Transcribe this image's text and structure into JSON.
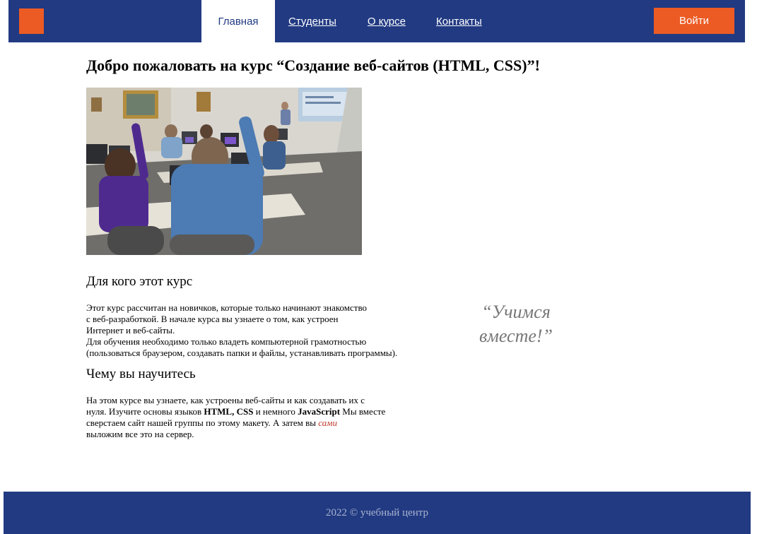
{
  "header": {
    "nav": [
      {
        "label": "Главная",
        "active": true
      },
      {
        "label": "Студенты",
        "active": false
      },
      {
        "label": "О курсе",
        "active": false
      },
      {
        "label": "Контакты",
        "active": false
      }
    ],
    "login_label": "Войти"
  },
  "main": {
    "title": "Добро пожаловать на курс “Создание веб-сайтов (HTML, CSS)”!",
    "section1": {
      "title": "Для кого этот курс",
      "lines": [
        "Этот курс рассчитан на новичков, которые только начинают знакомство",
        "с веб-разработкой. В начале курса вы узнаете о том, как устроен",
        "Интернет и веб-сайты.",
        "Для обучения необходимо только владеть компьютерной грамотностью",
        "(пользоваться браузером, создавать папки и файлы, устанавливать программы)."
      ]
    },
    "section2": {
      "title": "Чему вы научитесь",
      "line1": "На этом курсе вы узнаете, как устроены веб-сайты и как создавать их с",
      "line2_a": "нуля. Изучите основы языков ",
      "line2_b": "HTML, CSS",
      "line2_c": " и немного ",
      "line2_d": "JavaScript",
      "line2_e": " Мы вместе",
      "line3_a": "сверстаем сайт нашей группы по этому макету. А затем вы ",
      "line3_b": "сами",
      "line4": "выложим все это на сервер."
    },
    "quote": {
      "line1": "“Учимся",
      "line2": "вместе!”"
    }
  },
  "footer": {
    "text": "2022 © учебный центр"
  },
  "colors": {
    "primary": "#213a82",
    "accent": "#ec5b24"
  }
}
